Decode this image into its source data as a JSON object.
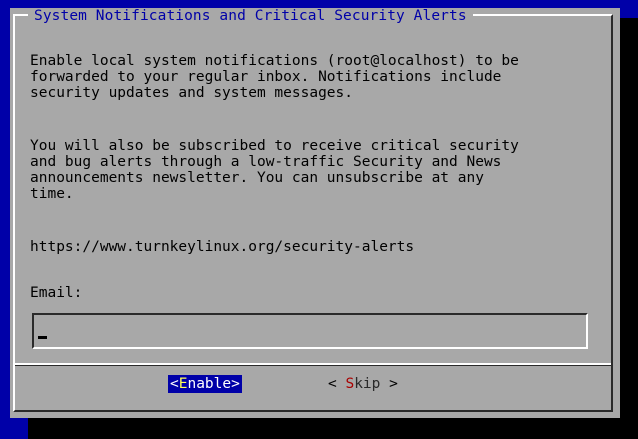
{
  "dialog": {
    "title": "System Notifications and Critical Security Alerts",
    "paragraph_1": "Enable local system notifications (root@localhost) to be\nforwarded to your regular inbox. Notifications include\nsecurity updates and system messages.",
    "paragraph_2": "You will also be subscribed to receive critical security\nand bug alerts through a low-traffic Security and News\nannouncements newsletter. You can unsubscribe at any\ntime.",
    "url": "https://www.turnkeylinux.org/security-alerts",
    "email_label": "Email:",
    "email_value": ""
  },
  "buttons": {
    "enable": {
      "open": "<",
      "hotkey": "E",
      "rest": "nable",
      "close": ">"
    },
    "skip": {
      "open": "< ",
      "hotkey": "S",
      "rest": "kip",
      "close": " >"
    }
  },
  "colors": {
    "background": "#0000a8",
    "dialog": "#a8a8a8",
    "title_text": "#0000a8",
    "selected_button_bg": "#0000a8",
    "selected_button_text": "#ffffff",
    "selected_hotkey": "#ffff55",
    "hotkey": "#a80000"
  }
}
